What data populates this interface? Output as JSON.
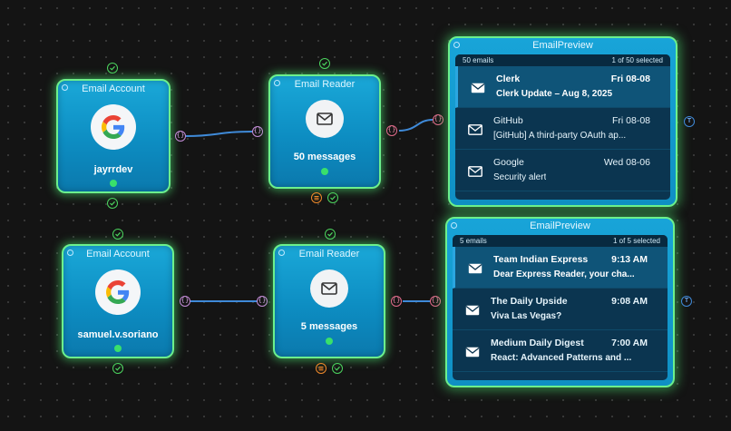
{
  "pipelines": [
    {
      "account": {
        "title": "Email Account",
        "name": "jayrrdev"
      },
      "reader": {
        "title": "Email Reader",
        "count": "50 messages"
      },
      "preview": {
        "title": "EmailPreview",
        "total": "50 emails",
        "selected": "1 of 50 selected",
        "emails": [
          {
            "from": "Clerk",
            "date": "Fri 08-08",
            "subject": "Clerk Update – Aug 8, 2025"
          },
          {
            "from": "GitHub",
            "date": "Fri 08-08",
            "subject": "[GitHub] A third-party OAuth ap..."
          },
          {
            "from": "Google",
            "date": "Wed 08-06",
            "subject": "Security alert"
          }
        ]
      }
    },
    {
      "account": {
        "title": "Email Account",
        "name": "samuel.v.soriano"
      },
      "reader": {
        "title": "Email Reader",
        "count": "5 messages"
      },
      "preview": {
        "title": "EmailPreview",
        "total": "5 emails",
        "selected": "1 of 5 selected",
        "emails": [
          {
            "from": "Team Indian Express",
            "date": "9:13 AM",
            "subject": "Dear Express Reader, your cha..."
          },
          {
            "from": "The Daily Upside",
            "date": "9:08 AM",
            "subject": "Viva Las Vegas?"
          },
          {
            "from": "Medium Daily Digest",
            "date": "7:00 AM",
            "subject": "React: Advanced Patterns and ..."
          }
        ]
      }
    }
  ],
  "ports": {
    "io": "{}",
    "text": "T"
  },
  "colors": {
    "node_border": "#6cf08c",
    "node_fill": "#0d8dc2",
    "wire": "#3f8ad8",
    "ok": "#39e06b",
    "warn": "#f08a2a"
  }
}
